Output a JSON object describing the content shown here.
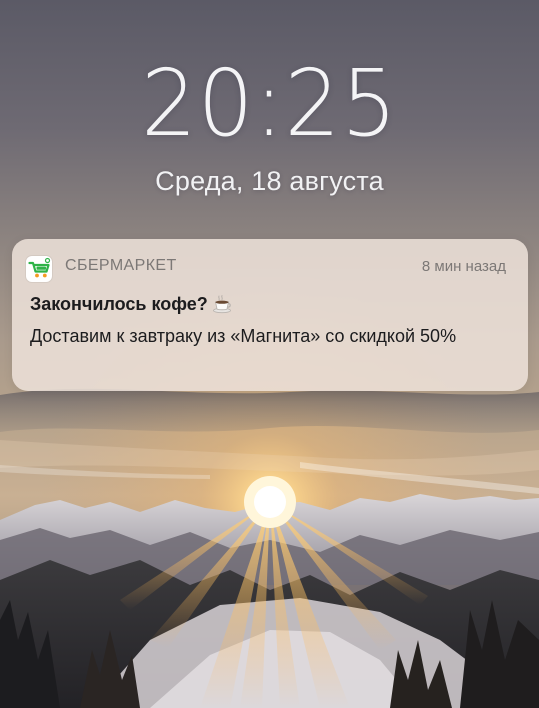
{
  "lock_screen": {
    "time": "20:25",
    "date": "Среда, 18 августа"
  },
  "notification": {
    "app_icon": "shopping-cart-icon",
    "app_name": "СБЕРМАРКЕТ",
    "time_ago": "8 мин назад",
    "title": "Закончилось кофе?",
    "title_emoji": "coffee-cup-icon",
    "body": "Доставим к завтраку из «Магнита» со скидкой 50%"
  },
  "colors": {
    "brand_green": "#2fb347",
    "brand_orange": "#f39a21",
    "sun": "#ffd58a"
  }
}
